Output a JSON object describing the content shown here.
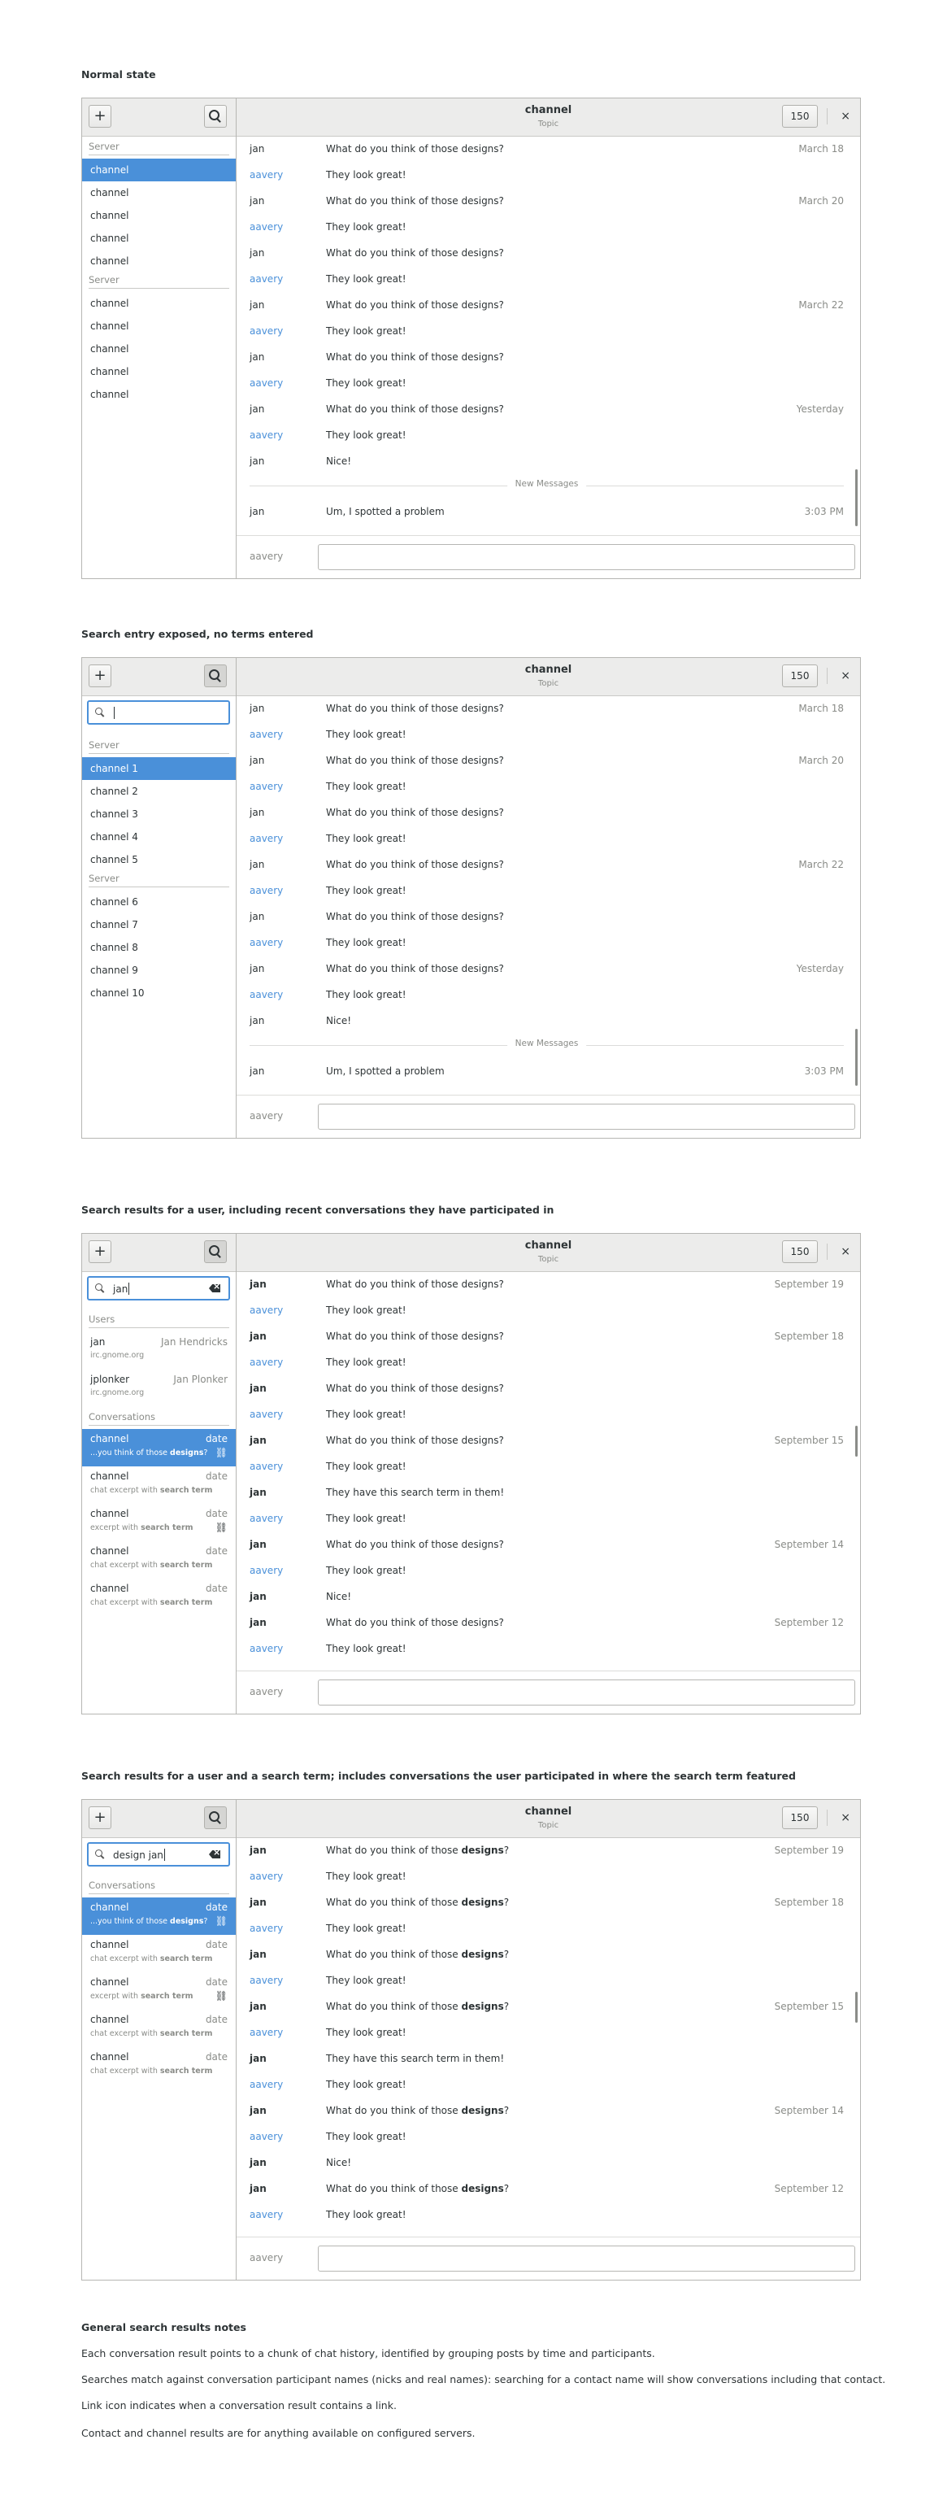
{
  "sections": {
    "s1": "Normal state",
    "s2": "Search entry exposed, no terms entered",
    "s3": "Search results for a user, including recent conversations they have participated in",
    "s4": "Search results for a user and a search term; includes conversations the user participated in where the search term featured"
  },
  "header": {
    "channel_title": "channel",
    "topic": "Topic",
    "user_count": "150",
    "close_glyph": "×",
    "add_glyph": "+"
  },
  "sidebar1": {
    "server1": "Server",
    "server2": "Server",
    "channels1": [
      "channel",
      "channel",
      "channel",
      "channel",
      "channel"
    ],
    "channels2": [
      "channel",
      "channel",
      "channel",
      "channel",
      "channel"
    ]
  },
  "sidebar2": {
    "server1": "Server",
    "server2": "Server",
    "channels1": [
      "channel 1",
      "channel 2",
      "channel 3",
      "channel 4",
      "channel 5"
    ],
    "channels2": [
      "channel 6",
      "channel 7",
      "channel 8",
      "channel 9",
      "channel 10"
    ]
  },
  "chat_normal": {
    "messages": [
      {
        "nick": "jan",
        "text": "What do you think of those designs?",
        "ts": "March 18"
      },
      {
        "nick": "aavery",
        "text": "They look great!",
        "ts": ""
      },
      {
        "nick": "jan",
        "text": "What do you think of those designs?",
        "ts": "March 20"
      },
      {
        "nick": "aavery",
        "text": "They look great!",
        "ts": ""
      },
      {
        "nick": "jan",
        "text": "What do you think of those designs?",
        "ts": ""
      },
      {
        "nick": "aavery",
        "text": "They look great!",
        "ts": ""
      },
      {
        "nick": "jan",
        "text": "What do you think of those designs?",
        "ts": "March 22"
      },
      {
        "nick": "aavery",
        "text": "They look great!",
        "ts": ""
      },
      {
        "nick": "jan",
        "text": "What do you think of those designs?",
        "ts": ""
      },
      {
        "nick": "aavery",
        "text": "They look great!",
        "ts": ""
      },
      {
        "nick": "jan",
        "text": "What do you think of those designs?",
        "ts": "Yesterday"
      },
      {
        "nick": "aavery",
        "text": "They look great!",
        "ts": ""
      },
      {
        "nick": "jan",
        "text": "Nice!",
        "ts": ""
      }
    ],
    "new_messages_label": "New Messages",
    "last": {
      "nick": "jan",
      "text": "Um, I spotted a problem",
      "ts": "3:03 PM"
    },
    "me": "aavery"
  },
  "search3": {
    "query": "jan",
    "users_label": "Users",
    "users": [
      {
        "nick": "jan",
        "real": "Jan Hendricks",
        "server": "irc.gnome.org"
      },
      {
        "nick": "jplonker",
        "real": "Jan Plonker",
        "server": "irc.gnome.org"
      }
    ],
    "conversations_label": "Conversations"
  },
  "search4": {
    "query": "design jan",
    "conversations_label": "Conversations"
  },
  "conversations": [
    {
      "name": "channel",
      "date": "date",
      "pre": "...you think of those ",
      "term": "designs",
      "post": "?",
      "link": true
    },
    {
      "name": "channel",
      "date": "date",
      "pre": "chat excerpt with ",
      "term": "search term",
      "post": "",
      "link": false
    },
    {
      "name": "channel",
      "date": "date",
      "pre": "excerpt with ",
      "term": "search term",
      "post": "",
      "link": true
    },
    {
      "name": "channel",
      "date": "date",
      "pre": "chat excerpt with ",
      "term": "search term",
      "post": "",
      "link": false
    },
    {
      "name": "channel",
      "date": "date",
      "pre": "chat excerpt with ",
      "term": "search term",
      "post": "",
      "link": false
    }
  ],
  "chat_results3": [
    {
      "nick": "jan",
      "text": "What do you think of those designs?",
      "ts": "September 19"
    },
    {
      "nick": "aavery",
      "text": "They look great!",
      "ts": ""
    },
    {
      "nick": "jan",
      "text": "What do you think of those designs?",
      "ts": "September 18"
    },
    {
      "nick": "aavery",
      "text": "They look great!",
      "ts": ""
    },
    {
      "nick": "jan",
      "text": "What do you think of those designs?",
      "ts": ""
    },
    {
      "nick": "aavery",
      "text": "They look great!",
      "ts": ""
    },
    {
      "nick": "jan",
      "text": "What do you think of those designs?",
      "ts": "September 15"
    },
    {
      "nick": "aavery",
      "text": "They look great!",
      "ts": ""
    },
    {
      "nick": "jan",
      "text": "They have this search term in them!",
      "ts": ""
    },
    {
      "nick": "aavery",
      "text": "They look great!",
      "ts": ""
    },
    {
      "nick": "jan",
      "text": "What do you think of those designs?",
      "ts": "September 14"
    },
    {
      "nick": "aavery",
      "text": "They look great!",
      "ts": ""
    },
    {
      "nick": "jan",
      "text": "Nice!",
      "ts": ""
    },
    {
      "nick": "jan",
      "text": "What do you think of those designs?",
      "ts": "September 12"
    },
    {
      "nick": "aavery",
      "text": "They look great!",
      "ts": ""
    }
  ],
  "chat_results4": [
    {
      "nick": "jan",
      "pre": "What do you think of those ",
      "term": "designs",
      "post": "?",
      "ts": "September 19"
    },
    {
      "nick": "aavery",
      "pre": "They look great!",
      "term": "",
      "post": "",
      "ts": ""
    },
    {
      "nick": "jan",
      "pre": "What do you think of those ",
      "term": "designs",
      "post": "?",
      "ts": "September 18"
    },
    {
      "nick": "aavery",
      "pre": "They look great!",
      "term": "",
      "post": "",
      "ts": ""
    },
    {
      "nick": "jan",
      "pre": "What do you think of those ",
      "term": "designs",
      "post": "?",
      "ts": ""
    },
    {
      "nick": "aavery",
      "pre": "They look great!",
      "term": "",
      "post": "",
      "ts": ""
    },
    {
      "nick": "jan",
      "pre": "What do you think of those ",
      "term": "designs",
      "post": "?",
      "ts": "September 15"
    },
    {
      "nick": "aavery",
      "pre": "They look great!",
      "term": "",
      "post": "",
      "ts": ""
    },
    {
      "nick": "jan",
      "pre": "They have this search term in them!",
      "term": "",
      "post": "",
      "ts": ""
    },
    {
      "nick": "aavery",
      "pre": "They look great!",
      "term": "",
      "post": "",
      "ts": ""
    },
    {
      "nick": "jan",
      "pre": "What do you think of those ",
      "term": "designs",
      "post": "?",
      "ts": "September 14"
    },
    {
      "nick": "aavery",
      "pre": "They look great!",
      "term": "",
      "post": "",
      "ts": ""
    },
    {
      "nick": "jan",
      "pre": "Nice!",
      "term": "",
      "post": "",
      "ts": ""
    },
    {
      "nick": "jan",
      "pre": "What do you think of those ",
      "term": "designs",
      "post": "?",
      "ts": "September 12"
    },
    {
      "nick": "aavery",
      "pre": "They look great!",
      "term": "",
      "post": "",
      "ts": ""
    }
  ],
  "notes": {
    "title": "General search results notes",
    "items": [
      "Each conversation result points to a chunk of chat history, identified by grouping posts by time and participants.",
      "Searches match against conversation participant names (nicks and real names): searching for a contact name will show conversations including that contact.",
      "Link icon indicates when a conversation result contains a link.",
      "Contact and channel results are for anything available on configured servers."
    ]
  },
  "colors": {
    "accent": "#4a90d9",
    "header_bg": "#ececeb",
    "border": "#b6b6b3"
  },
  "icons": [
    "add-icon",
    "search-icon",
    "close-icon",
    "clear-icon",
    "link-icon"
  ]
}
